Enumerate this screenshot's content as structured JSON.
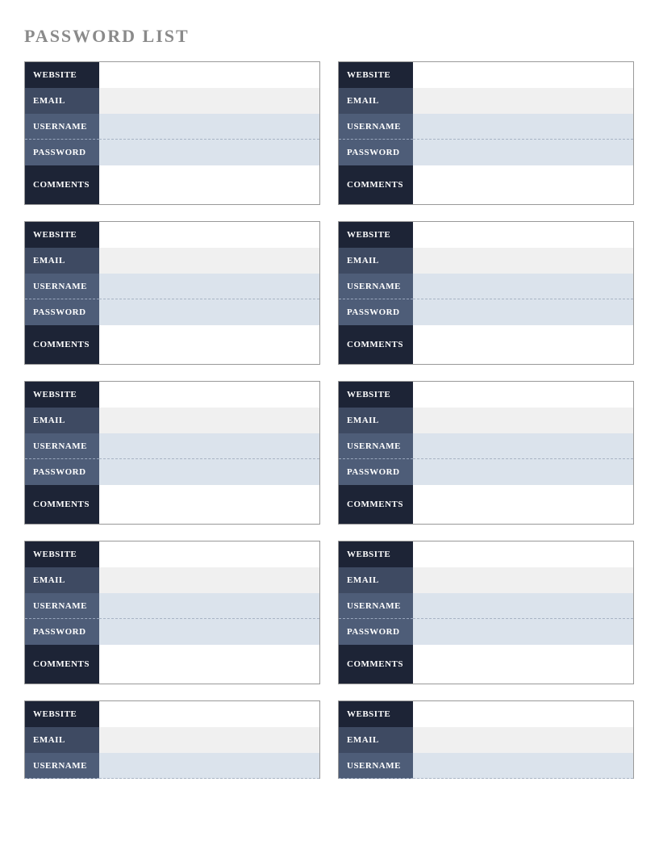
{
  "title": "PASSWORD LIST",
  "labels": {
    "website": "WEBSITE",
    "email": "EMAIL",
    "username": "USERNAME",
    "password": "PASSWORD",
    "comments": "COMMENTS"
  },
  "cards": [
    {
      "website": "",
      "email": "",
      "username": "",
      "password": "",
      "comments": ""
    },
    {
      "website": "",
      "email": "",
      "username": "",
      "password": "",
      "comments": ""
    },
    {
      "website": "",
      "email": "",
      "username": "",
      "password": "",
      "comments": ""
    },
    {
      "website": "",
      "email": "",
      "username": "",
      "password": "",
      "comments": ""
    },
    {
      "website": "",
      "email": "",
      "username": "",
      "password": "",
      "comments": ""
    },
    {
      "website": "",
      "email": "",
      "username": "",
      "password": "",
      "comments": ""
    },
    {
      "website": "",
      "email": "",
      "username": "",
      "password": "",
      "comments": ""
    },
    {
      "website": "",
      "email": "",
      "username": "",
      "password": "",
      "comments": ""
    },
    {
      "website": "",
      "email": "",
      "username": ""
    },
    {
      "website": "",
      "email": "",
      "username": ""
    }
  ]
}
